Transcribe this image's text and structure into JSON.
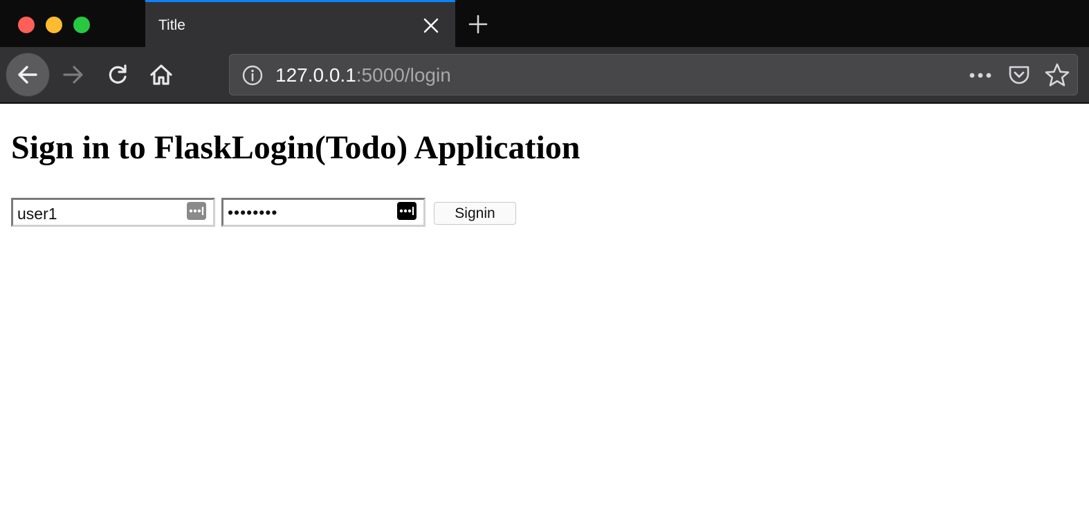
{
  "browser": {
    "tab": {
      "title": "Title"
    },
    "url": {
      "host": "127.0.0.1",
      "path": ":5000/login"
    },
    "accent_color": "#0a84ff",
    "icons": {
      "back": "arrow-left-icon",
      "forward": "arrow-right-icon",
      "reload": "reload-icon",
      "home": "home-icon",
      "site_info": "info-icon",
      "page_actions": "more-icon",
      "pocket": "pocket-icon",
      "bookmark": "star-icon",
      "close_tab": "close-icon",
      "new_tab": "plus-icon"
    }
  },
  "page": {
    "heading": "Sign in to FlaskLogin(Todo) Application",
    "form": {
      "username_value": "user1",
      "password_value": "••••••••",
      "submit_label": "Signin",
      "password_manager_icon": "password-manager-icon"
    }
  }
}
